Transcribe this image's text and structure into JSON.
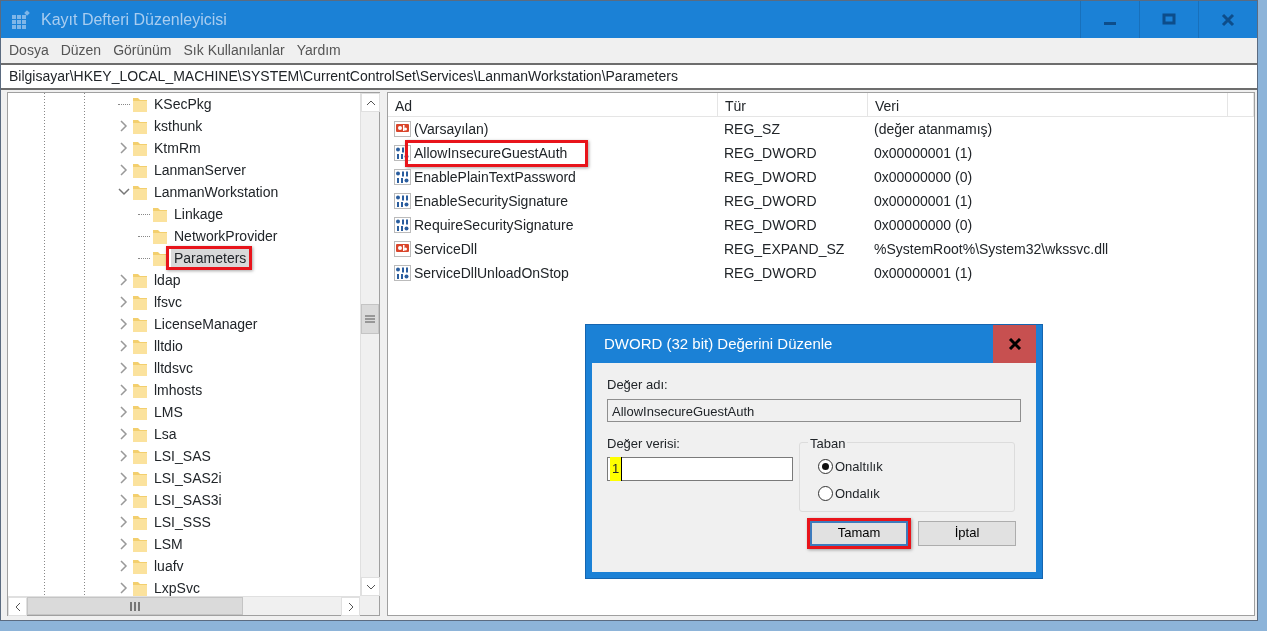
{
  "window": {
    "title": "Kayıt Defteri Düzenleyicisi"
  },
  "menu": [
    "Dosya",
    "Düzen",
    "Görünüm",
    "Sık Kullanılanlar",
    "Yardım"
  ],
  "address": "Bilgisayar\\HKEY_LOCAL_MACHINE\\SYSTEM\\CurrentControlSet\\Services\\LanmanWorkstation\\Parameters",
  "tree": [
    {
      "label": "KSecPkg",
      "kind": "leaf",
      "selected": false,
      "marked": false
    },
    {
      "label": "ksthunk",
      "kind": "branch",
      "expanded": false,
      "selected": false,
      "marked": false
    },
    {
      "label": "KtmRm",
      "kind": "branch",
      "expanded": false,
      "selected": false,
      "marked": false
    },
    {
      "label": "LanmanServer",
      "kind": "branch",
      "expanded": false,
      "selected": false,
      "marked": false
    },
    {
      "label": "LanmanWorkstation",
      "kind": "branch",
      "expanded": true,
      "selected": false,
      "marked": false,
      "children": [
        {
          "label": "Linkage",
          "kind": "leaf",
          "selected": false,
          "marked": false
        },
        {
          "label": "NetworkProvider",
          "kind": "leaf",
          "selected": false,
          "marked": false
        },
        {
          "label": "Parameters",
          "kind": "leaf",
          "selected": true,
          "marked": true
        }
      ]
    },
    {
      "label": "ldap",
      "kind": "branch",
      "expanded": false,
      "selected": false,
      "marked": false
    },
    {
      "label": "lfsvc",
      "kind": "branch",
      "expanded": false,
      "selected": false,
      "marked": false
    },
    {
      "label": "LicenseManager",
      "kind": "branch",
      "expanded": false,
      "selected": false,
      "marked": false
    },
    {
      "label": "lltdio",
      "kind": "branch",
      "expanded": false,
      "selected": false,
      "marked": false
    },
    {
      "label": "lltdsvc",
      "kind": "branch",
      "expanded": false,
      "selected": false,
      "marked": false
    },
    {
      "label": "lmhosts",
      "kind": "branch",
      "expanded": false,
      "selected": false,
      "marked": false
    },
    {
      "label": "LMS",
      "kind": "branch",
      "expanded": false,
      "selected": false,
      "marked": false
    },
    {
      "label": "Lsa",
      "kind": "branch",
      "expanded": false,
      "selected": false,
      "marked": false
    },
    {
      "label": "LSI_SAS",
      "kind": "branch",
      "expanded": false,
      "selected": false,
      "marked": false
    },
    {
      "label": "LSI_SAS2i",
      "kind": "branch",
      "expanded": false,
      "selected": false,
      "marked": false
    },
    {
      "label": "LSI_SAS3i",
      "kind": "branch",
      "expanded": false,
      "selected": false,
      "marked": false
    },
    {
      "label": "LSI_SSS",
      "kind": "branch",
      "expanded": false,
      "selected": false,
      "marked": false
    },
    {
      "label": "LSM",
      "kind": "branch",
      "expanded": false,
      "selected": false,
      "marked": false
    },
    {
      "label": "luafv",
      "kind": "branch",
      "expanded": false,
      "selected": false,
      "marked": false
    },
    {
      "label": "LxpSvc",
      "kind": "branch",
      "expanded": false,
      "selected": false,
      "marked": false
    }
  ],
  "values": {
    "columns": [
      "Ad",
      "Tür",
      "Veri"
    ],
    "rows": [
      {
        "kind": "string",
        "name": "(Varsayılan)",
        "type": "REG_SZ",
        "data": "(değer atanmamış)",
        "marked": false
      },
      {
        "kind": "binary",
        "name": "AllowInsecureGuestAuth",
        "type": "REG_DWORD",
        "data": "0x00000001 (1)",
        "marked": true
      },
      {
        "kind": "binary",
        "name": "EnablePlainTextPassword",
        "type": "REG_DWORD",
        "data": "0x00000000 (0)",
        "marked": false
      },
      {
        "kind": "binary",
        "name": "EnableSecuritySignature",
        "type": "REG_DWORD",
        "data": "0x00000001 (1)",
        "marked": false
      },
      {
        "kind": "binary",
        "name": "RequireSecuritySignature",
        "type": "REG_DWORD",
        "data": "0x00000000 (0)",
        "marked": false
      },
      {
        "kind": "string",
        "name": "ServiceDll",
        "type": "REG_EXPAND_SZ",
        "data": "%SystemRoot%\\System32\\wkssvc.dll",
        "marked": false
      },
      {
        "kind": "binary",
        "name": "ServiceDllUnloadOnStop",
        "type": "REG_DWORD",
        "data": "0x00000001 (1)",
        "marked": false
      }
    ]
  },
  "dialog": {
    "title": "DWORD (32 bit) Değerini Düzenle",
    "name_label": "Değer adı:",
    "name_value": "AllowInsecureGuestAuth",
    "data_label": "Değer verisi:",
    "data_value": "1",
    "data_highlighted": true,
    "base_label": "Taban",
    "bases": [
      {
        "label": "Onaltılık",
        "selected": true
      },
      {
        "label": "Ondalık",
        "selected": false
      }
    ],
    "buttons": [
      {
        "label": "Tamam",
        "default": true,
        "marked": true
      },
      {
        "label": "İptal",
        "default": false,
        "marked": false
      }
    ]
  }
}
